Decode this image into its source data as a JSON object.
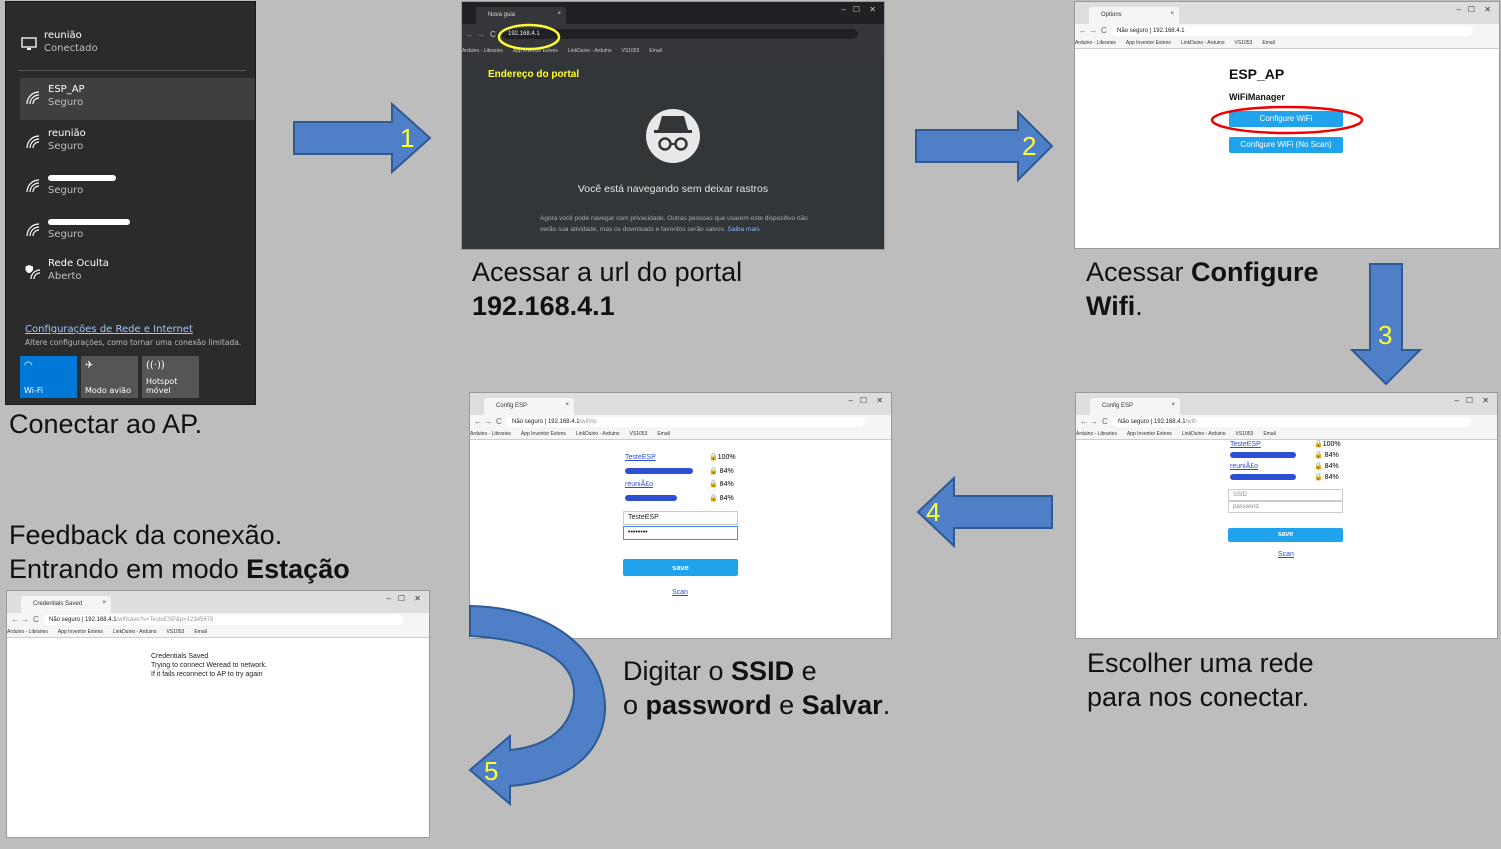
{
  "captions": {
    "step0": "Conectar ao AP.",
    "step1_line1": "Acessar a url do portal",
    "step1_line2": "192.168.4.1",
    "step2_pre": "Acessar ",
    "step2_bold1": "Configure",
    "step2_bold2": "Wifi",
    "step2_post": ".",
    "step3_line1": "Escolher uma rede",
    "step3_line2": "para nos conectar.",
    "step4_pre1": "Digitar o ",
    "step4_bold1": "SSID",
    "step4_post1": " e",
    "step4_pre2": "o ",
    "step4_bold2": "password",
    "step4_mid2": " e ",
    "step4_bold3": "Salvar",
    "step4_post2": ".",
    "step5_line1": "Feedback da conexão.",
    "step5_pre2": "Entrando em modo ",
    "step5_bold2": "Estação"
  },
  "arrow_numbers": [
    "1",
    "2",
    "3",
    "4",
    "5"
  ],
  "colors": {
    "arrow_fill": "#4f7fc6",
    "arrow_stroke": "#2e5a96",
    "arrow_number": "#ffff33",
    "esp_button": "#1fa3ec",
    "windows_accent": "#0078d7"
  },
  "wifi_panel": {
    "connected": {
      "name": "reunião",
      "status": "Conectado"
    },
    "networks": [
      {
        "name": "ESP_AP",
        "status": "Seguro"
      },
      {
        "name": "reunião",
        "status": "Seguro"
      },
      {
        "name": "",
        "status": "Seguro"
      },
      {
        "name": "",
        "status": "Seguro"
      },
      {
        "name": "Rede Oculta",
        "status": "Aberto"
      }
    ],
    "settings_link": "Configurações de Rede e Internet",
    "settings_sub": "Altere configurações, como tornar uma conexão limitada.",
    "tiles": [
      "Wi-Fi",
      "Modo avião",
      "Hotspot móvel"
    ]
  },
  "bookmarks": [
    "Arduino - Libraries",
    "App Inventor Extens",
    "LinkDuino - Arduino",
    "VS1053",
    "Email"
  ],
  "browser1": {
    "tab": "Nova guia",
    "url": "192.168.4.1",
    "annotation": "Endereço do portal",
    "headline": "Você está navegando sem deixar rastros",
    "body_line1": "Agora você pode navegar com privacidade. Outras pessoas que usarem este dispositivo não",
    "body_line2": "verão sua atividade, mas os downloads e favoritos serão salvos.",
    "learn_more": "Saiba mais"
  },
  "browser2": {
    "tab": "Options",
    "secure": "Não seguro",
    "url": "192.168.4.1",
    "title": "ESP_AP",
    "subtitle": "WiFiManager",
    "btn_configure": "Configure WiFi",
    "btn_noscan": "Configure WiFi (No Scan)"
  },
  "browser3": {
    "tab": "Config ESP",
    "secure": "Não seguro",
    "url": "192.168.4.1",
    "url_path": "/wifi",
    "networks": [
      {
        "name": "TesteESP",
        "signal": "100%"
      },
      {
        "name": "",
        "signal": "84%"
      },
      {
        "name": "reuniÃ£o",
        "signal": "84%"
      },
      {
        "name": "",
        "signal": "84%"
      }
    ],
    "ssid_placeholder": "SSID",
    "password_placeholder": "password",
    "save": "save",
    "scan": "Scan"
  },
  "browser4": {
    "tab": "Config ESP",
    "secure": "Não seguro",
    "url": "192.168.4.1",
    "url_path": "/wifi#p",
    "networks": [
      {
        "name": "TesteESP",
        "signal": "100%"
      },
      {
        "name": "",
        "signal": "84%"
      },
      {
        "name": "reuniÃ£o",
        "signal": "84%"
      },
      {
        "name": "",
        "signal": "84%"
      }
    ],
    "ssid_value": "TesteESP",
    "password_value": "••••••••",
    "save": "save",
    "scan": "Scan"
  },
  "browser5": {
    "tab": "Credentials Saved",
    "secure": "Não seguro",
    "url": "192.168.4.1",
    "url_path": "/wifisave?s=TesteESP&p=12345678",
    "line1": "Credentials Saved",
    "line2": "Trying to connect Weread to network.",
    "line3": "If it fails reconnect to AP to try again"
  }
}
